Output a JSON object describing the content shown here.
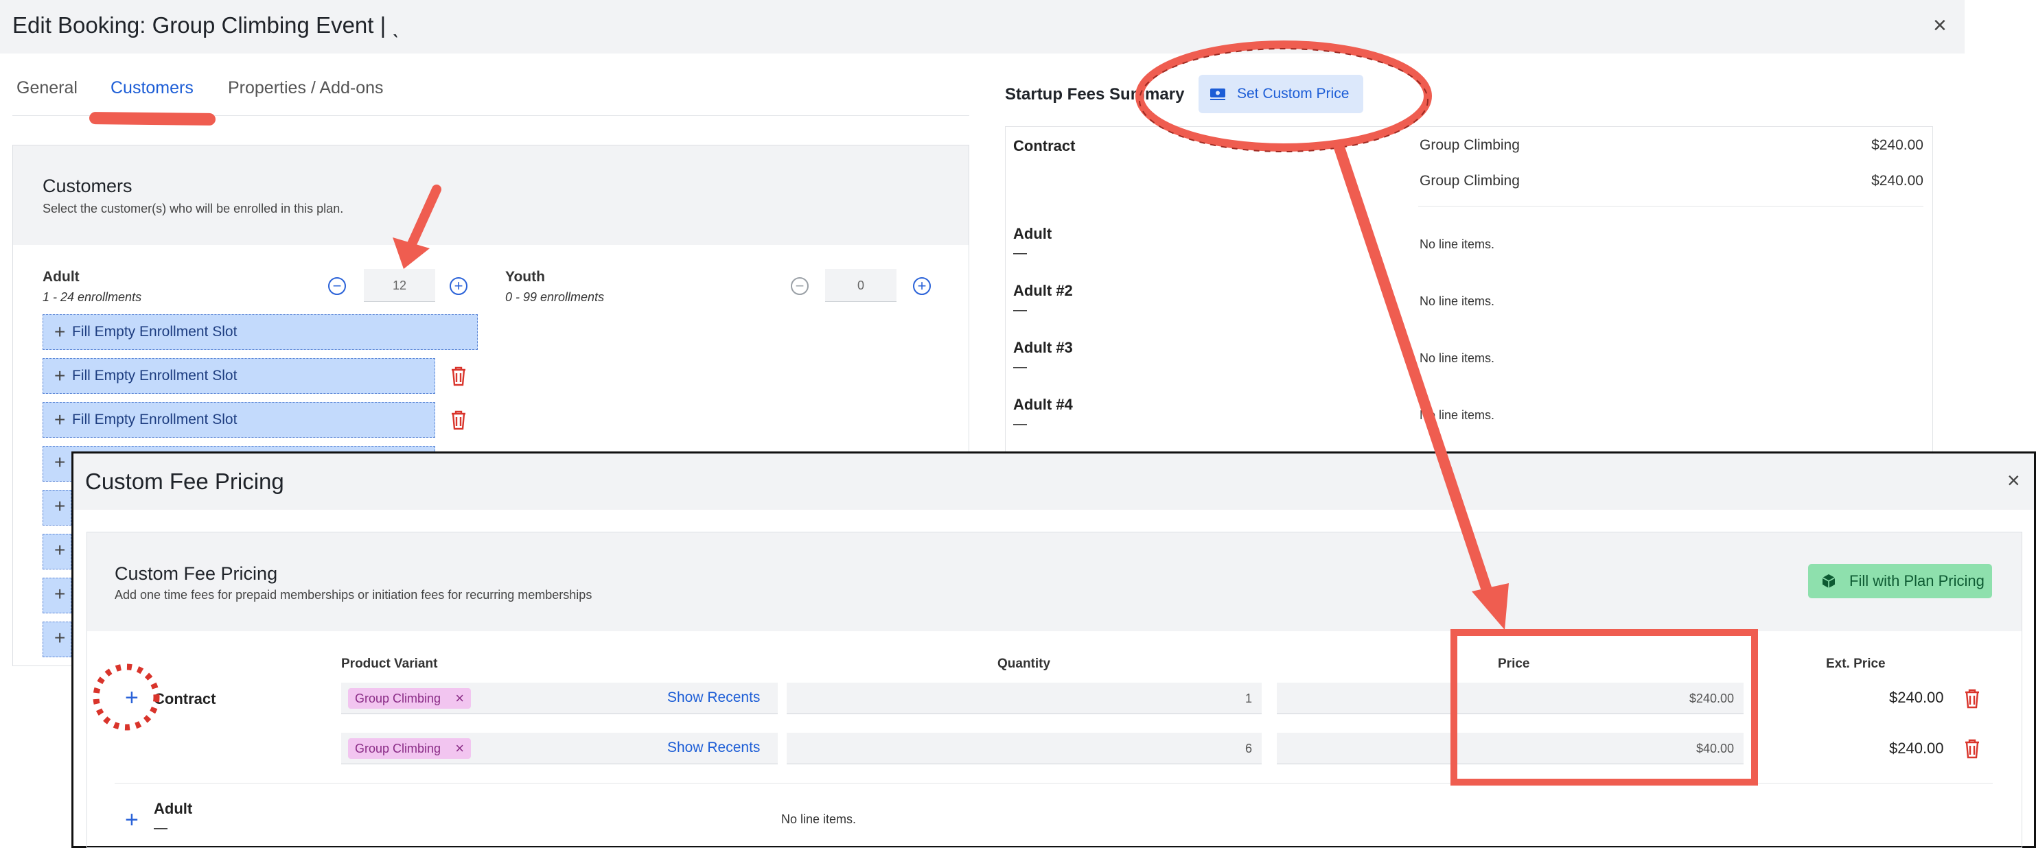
{
  "background_modal": {
    "title": "Edit Booking: Group Climbing Event | ˎ",
    "tabs": [
      {
        "label": "General"
      },
      {
        "label": "Customers"
      },
      {
        "label": "Properties / Add-ons"
      }
    ],
    "customers_panel": {
      "title": "Customers",
      "subtitle": "Select the customer(s) who will be enrolled in this plan.",
      "groups": [
        {
          "label": "Adult",
          "range": "1 - 24 enrollments",
          "count": "12"
        },
        {
          "label": "Youth",
          "range": "0 - 99 enrollments",
          "count": "0"
        }
      ],
      "slot_label": "Fill Empty Enrollment Slot"
    },
    "summary": {
      "title": "Startup Fees Summary",
      "custom_price_button": "Set Custom Price",
      "rows": [
        {
          "label": "Contract",
          "items": [
            {
              "name": "Group Climbing",
              "amount": "$240.00"
            },
            {
              "name": "Group Climbing",
              "amount": "$240.00"
            }
          ]
        },
        {
          "label": "Adult",
          "dash": "—",
          "note": "No line items."
        },
        {
          "label": "Adult #2",
          "dash": "—",
          "note": "No line items."
        },
        {
          "label": "Adult #3",
          "dash": "—",
          "note": "No line items."
        },
        {
          "label": "Adult #4",
          "dash": "—",
          "note": "No line items."
        }
      ]
    }
  },
  "foreground_modal": {
    "title": "Custom Fee Pricing",
    "panel_title": "Custom Fee Pricing",
    "panel_description": "Add one time fees for prepaid memberships or initiation fees for recurring memberships",
    "fill_button": "Fill with Plan Pricing",
    "columns": {
      "variant": "Product Variant",
      "quantity": "Quantity",
      "price": "Price",
      "ext_price": "Ext. Price"
    },
    "contract": {
      "label": "Contract",
      "lines": [
        {
          "variant": "Group Climbing",
          "recents": "Show Recents",
          "quantity": "1",
          "price": "$240.00",
          "ext_price": "$240.00"
        },
        {
          "variant": "Group Climbing",
          "recents": "Show Recents",
          "quantity": "6",
          "price": "$40.00",
          "ext_price": "$240.00"
        }
      ]
    },
    "adult": {
      "label": "Adult",
      "dash": "—",
      "note": "No line items."
    }
  },
  "colors": {
    "accent_blue": "#1c5dd6",
    "annotation_red": "#ef5d50",
    "delete_red": "#d9342b",
    "success_green": "#8ee0ad",
    "chip_pink": "#f2c5f0"
  }
}
